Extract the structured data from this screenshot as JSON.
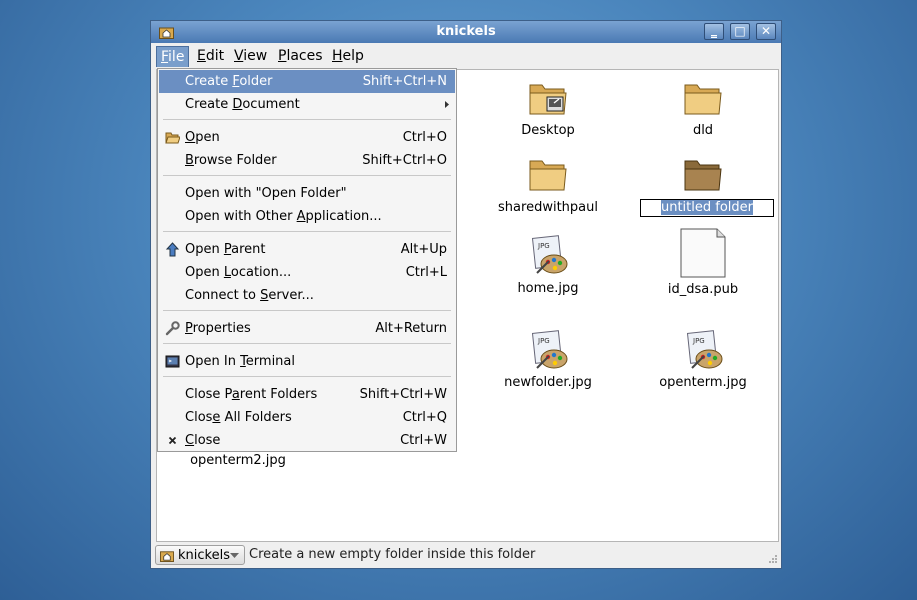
{
  "window": {
    "title": "knickels"
  },
  "menubar": {
    "items": [
      {
        "label": "File",
        "mnemonic": "F",
        "rest": "ile"
      },
      {
        "label": "Edit",
        "mnemonic": "E",
        "rest": "dit"
      },
      {
        "label": "View",
        "mnemonic": "V",
        "rest": "iew"
      },
      {
        "label": "Places",
        "mnemonic": "P",
        "rest": "laces"
      },
      {
        "label": "Help",
        "mnemonic": "H",
        "rest": "elp"
      }
    ]
  },
  "file_menu": {
    "create_folder": {
      "pre": "Create ",
      "mn": "F",
      "post": "older",
      "accel": "Shift+Ctrl+N"
    },
    "create_document": {
      "pre": "Create ",
      "mn": "D",
      "post": "ocument"
    },
    "open": {
      "pre": "",
      "mn": "O",
      "post": "pen",
      "accel": "Ctrl+O"
    },
    "browse_folder": {
      "pre": "",
      "mn": "B",
      "post": "rowse Folder",
      "accel": "Shift+Ctrl+O"
    },
    "open_with_open_folder": {
      "label": "Open with \"Open Folder\""
    },
    "open_with_other": {
      "pre": "Open with Other ",
      "mn": "A",
      "post": "pplication..."
    },
    "open_parent": {
      "pre": "Open ",
      "mn": "P",
      "post": "arent",
      "accel": "Alt+Up"
    },
    "open_location": {
      "pre": "Open ",
      "mn": "L",
      "post": "ocation...",
      "accel": "Ctrl+L"
    },
    "connect_to_server": {
      "pre": "Connect to ",
      "mn": "S",
      "post": "erver..."
    },
    "properties": {
      "pre": "",
      "mn": "P",
      "post": "roperties",
      "accel": "Alt+Return"
    },
    "open_in_terminal": {
      "pre": "Open In ",
      "mn": "T",
      "post": "erminal"
    },
    "close_parent_folders": {
      "pre": "Close P",
      "mn": "a",
      "post": "rent Folders",
      "accel": "Shift+Ctrl+W"
    },
    "close_all_folders": {
      "pre": "Clos",
      "mn": "e",
      "post": " All Folders",
      "accel": "Ctrl+Q"
    },
    "close": {
      "pre": "",
      "mn": "C",
      "post": "lose",
      "accel": "Ctrl+W"
    }
  },
  "files": {
    "desktop": "Desktop",
    "dld": "dld",
    "sharedwithpaul": "sharedwithpaul",
    "untitled_folder": "untitled folder",
    "home_jpg": "home.jpg",
    "id_dsa_pub": "id_dsa.pub",
    "newfolder_jpg": "newfolder.jpg",
    "openterm_jpg": "openterm.jpg",
    "openterm2_jpg": "openterm2.jpg",
    "jpg_badge": "JPG"
  },
  "statusbar": {
    "location": "knickels",
    "message": "Create a new empty folder inside this folder"
  },
  "colors": {
    "selection": "#6b8fc2",
    "titlebar": "#4a79b3",
    "folder": "#e4b868"
  }
}
